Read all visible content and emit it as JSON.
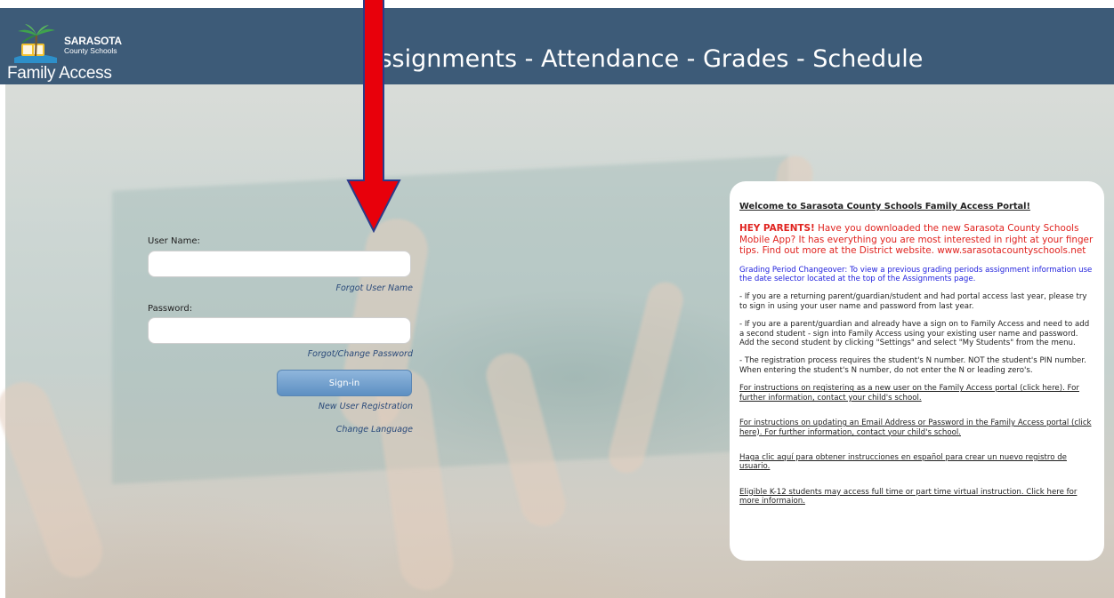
{
  "header": {
    "logo_name": "SARASOTA",
    "logo_sub": "County Schools",
    "app_name": "Family Access",
    "title": "Assignments - Attendance - Grades - Schedule"
  },
  "login": {
    "username_label": "User Name:",
    "username_value": "",
    "forgot_username": "Forgot User Name",
    "password_label": "Password:",
    "password_value": "",
    "forgot_password": "Forgot/Change Password",
    "signin_label": "Sign-in",
    "new_user": "New User Registration",
    "change_language": "Change Language"
  },
  "welcome": {
    "title": "Welcome to Sarasota County Schools Family Access Portal!",
    "hey_bold": "HEY PARENTS!",
    "hey_text": " Have you downloaded the new Sarasota County Schools Mobile App? It has everything you are most interested in right at your finger tips. Find out more at the District website. www.sarasotacountyschools.net",
    "grading": "Grading Period Changeover: To view a previous grading periods assignment information use the date selector located at the top of the Assignments page.",
    "returning": "- If you are a returning parent/guardian/student and had portal access last year, please try to sign in using your user name and password from last year.",
    "second_student": "- If you are a parent/guardian and already have a sign on to Family Access and need to add a second student - sign into Family Access using your existing user name and password. Add the second student by clicking \"Settings\" and select \"My Students\" from the menu.",
    "registration": "- The registration process requires the student's N number. NOT the student's PIN number. When entering the student's N number, do not enter the N or leading zero's.",
    "link_register": "For instructions on registering as a new user on the Family Access portal (click here). For further information, contact your child's school.",
    "link_email": "For instructions on updating an Email Address or Password in the Family Access portal (click here). For further information, contact your child's school.",
    "link_spanish": "Haga clic aquí para obtener instrucciones en español para crear un nuevo registro de usuario.",
    "link_virtual": "Eligible K-12 students may access full time or part time virtual instruction. Click here for more informaion."
  },
  "colors": {
    "header_bg": "#3d5b78",
    "arrow": "#e8000b",
    "hey_red": "#e0231f",
    "grading_blue": "#2222dd",
    "signin_blue": "#6f9ccc"
  }
}
